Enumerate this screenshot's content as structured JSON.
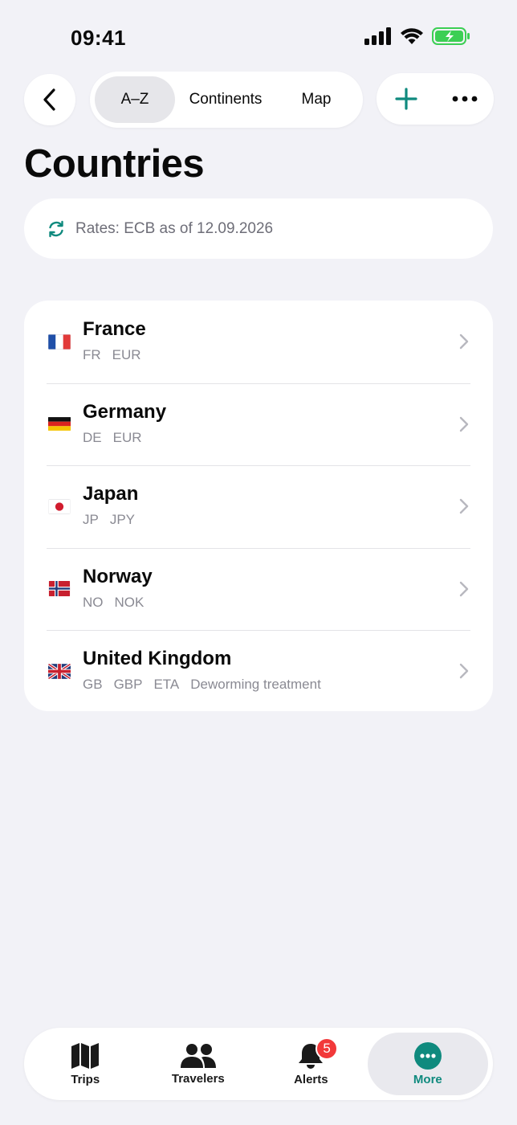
{
  "status": {
    "time": "09:41"
  },
  "tabs_top": [
    {
      "label": "A–Z",
      "active": true
    },
    {
      "label": "Continents",
      "active": false
    },
    {
      "label": "Map",
      "active": false
    }
  ],
  "header": {
    "title": "Countries"
  },
  "rates": {
    "text": "Rates: ECB as of 12.09.2026"
  },
  "countries": [
    {
      "name": "France",
      "meta": [
        "FR",
        "EUR"
      ],
      "flag": "flag-france"
    },
    {
      "name": "Germany",
      "meta": [
        "DE",
        "EUR"
      ],
      "flag": "flag-germany"
    },
    {
      "name": "Japan",
      "meta": [
        "JP",
        "JPY"
      ],
      "flag": "flag-japan"
    },
    {
      "name": "Norway",
      "meta": [
        "NO",
        "NOK"
      ],
      "flag": "flag-norway"
    },
    {
      "name": "United Kingdom",
      "meta": [
        "GB",
        "GBP",
        "ETA",
        "Deworming treatment"
      ],
      "flag": "flag-uk"
    }
  ],
  "tabbar": {
    "items": [
      {
        "label": "Trips",
        "icon": "map-icon"
      },
      {
        "label": "Travelers",
        "icon": "people-icon"
      },
      {
        "label": "Alerts",
        "icon": "bell-icon",
        "badge": "5"
      },
      {
        "label": "More",
        "icon": "more-circle-icon",
        "active": true
      }
    ]
  },
  "colors": {
    "accent": "#0f8a7e",
    "badge": "#f2393a",
    "background": "#f2f2f7"
  }
}
